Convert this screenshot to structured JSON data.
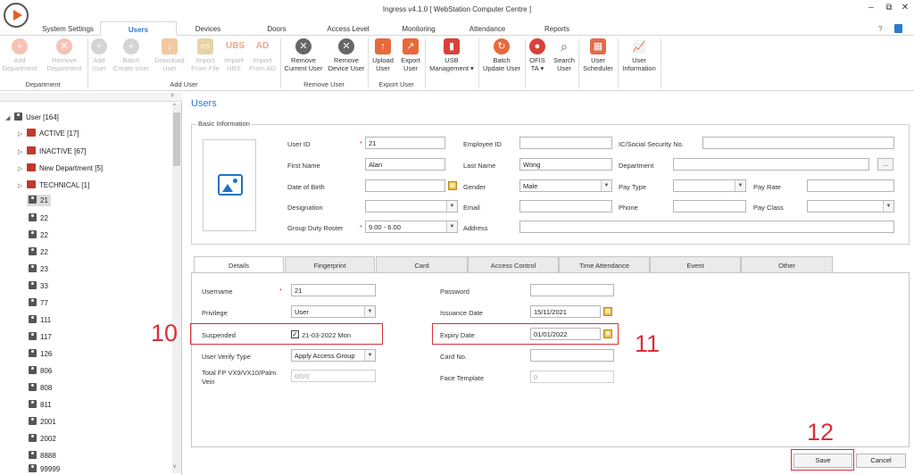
{
  "window": {
    "title": "Ingress v4.1.0 [ WebStation Computer Centre ]",
    "minimize": "–",
    "maximize": "⧉",
    "close": "✕"
  },
  "menu_tabs": [
    "System Settings",
    "Users",
    "Devices",
    "Doors",
    "Access Level",
    "Monitoring",
    "Attendance",
    "Reports"
  ],
  "ribbon": {
    "buttons": [
      {
        "l1": "Add",
        "l2": "Department",
        "icon": "add-department-icon",
        "enabled": false
      },
      {
        "l1": "Remove",
        "l2": "Department",
        "icon": "remove-department-icon",
        "enabled": false
      },
      {
        "l1": "Add",
        "l2": "User",
        "icon": "add-user-icon",
        "enabled": false
      },
      {
        "l1": "Batch",
        "l2": "Create User",
        "icon": "batch-create-user-icon",
        "enabled": false
      },
      {
        "l1": "Download",
        "l2": "User",
        "icon": "download-user-icon",
        "enabled": false
      },
      {
        "l1": "Import",
        "l2": "From File",
        "icon": "import-file-icon",
        "enabled": false
      },
      {
        "l1": "Import",
        "l2": "UBS",
        "icon": "import-ubs-icon",
        "glyph": "UBS",
        "enabled": false
      },
      {
        "l1": "Import",
        "l2": "From AD",
        "icon": "import-ad-icon",
        "glyph": "AD",
        "enabled": false
      },
      {
        "l1": "Remove",
        "l2": "Current User",
        "icon": "remove-current-user-icon",
        "enabled": true
      },
      {
        "l1": "Remove",
        "l2": "Device User",
        "icon": "remove-device-user-icon",
        "enabled": true
      },
      {
        "l1": "Upload",
        "l2": "User",
        "icon": "upload-user-icon",
        "enabled": true
      },
      {
        "l1": "Export",
        "l2": "User",
        "icon": "export-user-icon",
        "enabled": true
      },
      {
        "l1": "USB",
        "l2": "Management ▾",
        "icon": "usb-icon",
        "enabled": true
      },
      {
        "l1": "Batch",
        "l2": "Update User",
        "icon": "batch-update-icon",
        "enabled": true
      },
      {
        "l1": "OFIS",
        "l2": "TA ▾",
        "icon": "ofis-icon",
        "enabled": true
      },
      {
        "l1": "Search",
        "l2": "User",
        "icon": "search-icon",
        "enabled": true
      },
      {
        "l1": "User",
        "l2": "Scheduler",
        "icon": "scheduler-icon",
        "enabled": true
      },
      {
        "l1": "User",
        "l2": "Information",
        "icon": "user-info-icon",
        "enabled": true
      }
    ],
    "groups": [
      "Department",
      "Add User",
      "Remove User",
      "Export User"
    ]
  },
  "tree": {
    "root": "User [164]",
    "groups": [
      "ACTIVE [17]",
      "INACTIVE [67]",
      "New Department [5]",
      "TECHNICAL [1]"
    ],
    "users": [
      "21",
      "22",
      "22",
      "22",
      "23",
      "33",
      "77",
      "111",
      "117",
      "126",
      "806",
      "808",
      "811",
      "2001",
      "2002",
      "8888",
      "99999"
    ]
  },
  "main": {
    "title": "Users",
    "basic_legend": "Basic Information",
    "labels": {
      "user_id": "User ID",
      "first_name": "First Name",
      "dob": "Date of Birth",
      "designation": "Designation",
      "roster": "Group Duty Roster",
      "employee_id": "Employee ID",
      "last_name": "Last Name",
      "gender": "Gender",
      "email": "Email",
      "address": "Address",
      "ic": "IC/Social Security No.",
      "department": "Department",
      "pay_type": "Pay Type",
      "phone": "Phone",
      "pay_rate": "Pay Rate",
      "pay_class": "Pay Class"
    },
    "values": {
      "user_id": "21",
      "first_name": "Alan",
      "last_name": "Wong",
      "gender": "Male",
      "roster": "9.00 - 6.00",
      "dob": "",
      "designation": "",
      "employee_id": "",
      "email": "",
      "address": "",
      "ic": "",
      "department": "",
      "pay_type": "",
      "phone": "",
      "pay_rate": "",
      "pay_class": ""
    },
    "browse_label": "..."
  },
  "tabs": [
    "Details",
    "Fingerprint",
    "Card",
    "Access Control",
    "Time Attendance",
    "Event",
    "Other"
  ],
  "details": {
    "labels": {
      "username": "Username",
      "privilege": "Privilege",
      "suspended": "Suspended",
      "verify_type": "User Verify Type",
      "total_fp": "Total FP VX9/VX10/Palm",
      "total_fp2": "Vein",
      "password": "Password",
      "issuance": "Issuance Date",
      "expiry": "Expiry Date",
      "card_no": "Card No.",
      "face": "Face Template"
    },
    "values": {
      "username": "21",
      "privilege": "User",
      "suspended": "21-03-2022 Mon",
      "suspended_checked": "✓",
      "verify_type": "Apply Access Group",
      "total_fp": "0/0/0",
      "password": "",
      "issuance": "15/11/2021",
      "expiry": "01/01/2022",
      "card_no": "",
      "face": "0"
    }
  },
  "annotations": {
    "a10": "10",
    "a11": "11",
    "a12": "12"
  },
  "buttons": {
    "save": "Save",
    "cancel": "Cancel"
  }
}
